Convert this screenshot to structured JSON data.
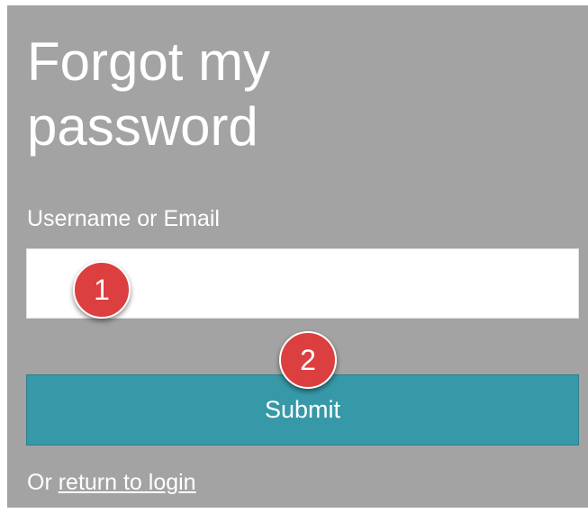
{
  "form": {
    "title": "Forgot my password",
    "field_label": "Username or Email",
    "input_value": "",
    "submit_label": "Submit",
    "footer_prefix": "Or ",
    "footer_link": "return to login"
  },
  "markers": [
    {
      "label": "1"
    },
    {
      "label": "2"
    }
  ],
  "colors": {
    "panel_bg": "#a3a3a3",
    "button_bg": "#3799a7",
    "marker_bg": "#dc3f3f",
    "text": "#ffffff"
  }
}
